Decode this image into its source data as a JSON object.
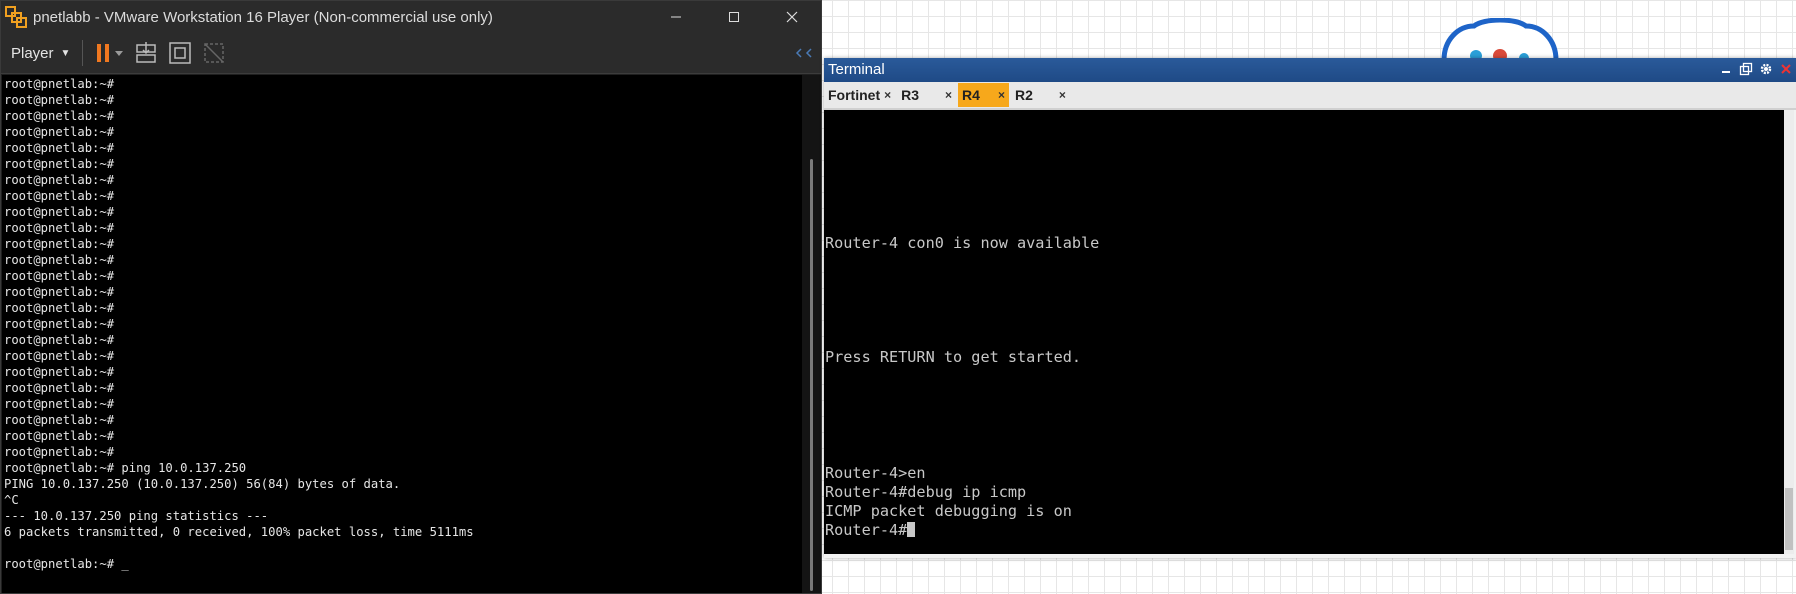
{
  "vmware": {
    "title": "pnetlabb - VMware Workstation 16 Player (Non-commercial use only)",
    "player_menu": "Player",
    "console_prompt_repeats": [
      "root@pnetlab:~#",
      "root@pnetlab:~#",
      "root@pnetlab:~#",
      "root@pnetlab:~#",
      "root@pnetlab:~#",
      "root@pnetlab:~#",
      "root@pnetlab:~#",
      "root@pnetlab:~#",
      "root@pnetlab:~#",
      "root@pnetlab:~#",
      "root@pnetlab:~#",
      "root@pnetlab:~#",
      "root@pnetlab:~#",
      "root@pnetlab:~#",
      "root@pnetlab:~#",
      "root@pnetlab:~#",
      "root@pnetlab:~#",
      "root@pnetlab:~#",
      "root@pnetlab:~#",
      "root@pnetlab:~#",
      "root@pnetlab:~#",
      "root@pnetlab:~#",
      "root@pnetlab:~#",
      "root@pnetlab:~#"
    ],
    "console_tail": [
      "root@pnetlab:~# ping 10.0.137.250",
      "PING 10.0.137.250 (10.0.137.250) 56(84) bytes of data.",
      "^C",
      "--- 10.0.137.250 ping statistics ---",
      "6 packets transmitted, 0 received, 100% packet loss, time 5111ms",
      "",
      "root@pnetlab:~# _"
    ]
  },
  "terminal": {
    "title": "Terminal",
    "tabs": [
      {
        "label": "Fortinet",
        "active": false
      },
      {
        "label": "R3",
        "active": false
      },
      {
        "label": "R4",
        "active": true
      },
      {
        "label": "R2",
        "active": false
      }
    ],
    "tab_close_glyph": "×",
    "lines": {
      "con0": "Router-4 con0 is now available",
      "press_return": "Press RETURN to get started.",
      "en": "Router-4>en",
      "debug_cmd": "Router-4#debug ip icmp",
      "debug_on": "ICMP packet debugging is on",
      "prompt": "Router-4#"
    }
  },
  "icons": {
    "app": "vmware-player-icon",
    "minimize": "minimize-icon",
    "maximize": "maximize-icon",
    "close": "close-icon",
    "pause": "pause-icon",
    "send_keys": "send-ctrl-alt-del-icon",
    "fullscreen": "fullscreen-icon",
    "unity": "unity-icon",
    "collapse": "collapse-toolbar-icon"
  },
  "colors": {
    "accent_orange": "#f7a81b",
    "terminal_titlebar": "#2a5a9a",
    "vmware_chrome": "#2b2b2b"
  }
}
